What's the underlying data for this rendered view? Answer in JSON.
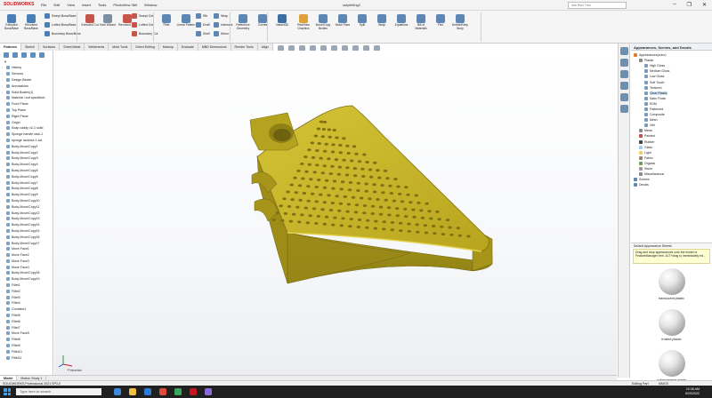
{
  "app": {
    "brand": "SOLIDWORKS",
    "document_title": "sstyletting2",
    "search_placeholder": "Ask Ravi Tran"
  },
  "menus": [
    "File",
    "Edit",
    "View",
    "Insert",
    "Tools",
    "PhotoView 360",
    "Window"
  ],
  "window_controls": [
    "–",
    "❐",
    "✕"
  ],
  "ribbon": {
    "big_tools": [
      {
        "label": "Extruded Boss/Base",
        "color": "#4a7fb8"
      },
      {
        "label": "Revolved Boss/Base",
        "color": "#4a7fb8"
      },
      {
        "label": "Extruded Cut",
        "color": "#c8554a"
      },
      {
        "label": "Hole Wizard",
        "color": "#7c8fa4"
      },
      {
        "label": "Revolved Cut",
        "color": "#c8554a"
      },
      {
        "label": "Fillet",
        "color": "#5f87b5"
      },
      {
        "label": "Linear Pattern",
        "color": "#5f87b5"
      },
      {
        "label": "Reference Geometry",
        "color": "#5f87b5"
      },
      {
        "label": "Curves",
        "color": "#5f87b5"
      },
      {
        "label": "Instant3D",
        "color": "#3a6ea5"
      },
      {
        "label": "RealView Graphics",
        "color": "#e0a03a"
      },
      {
        "label": "Move/Copy Bodies",
        "color": "#5f87b5"
      },
      {
        "label": "Move Face",
        "color": "#5f87b5"
      },
      {
        "label": "Split",
        "color": "#5f87b5"
      },
      {
        "label": "Wrap",
        "color": "#5f87b5"
      },
      {
        "label": "Equations",
        "color": "#5f87b5"
      },
      {
        "label": "Bill of Materials",
        "color": "#5f87b5"
      },
      {
        "label": "Flex",
        "color": "#5f87b5"
      },
      {
        "label": "Delete/Keep Body",
        "color": "#5f87b5"
      }
    ],
    "small_tools": [
      {
        "label": "Swept Boss/Base",
        "color": "#4a7fb8"
      },
      {
        "label": "Lofted Boss/Base",
        "color": "#4a7fb8"
      },
      {
        "label": "Boundary Boss/Base",
        "color": "#4a7fb8"
      },
      {
        "label": "Swept Cut",
        "color": "#c8554a"
      },
      {
        "label": "Lofted Cut",
        "color": "#c8554a"
      },
      {
        "label": "Boundary Cut",
        "color": "#c8554a"
      },
      {
        "label": "Rib",
        "color": "#5f87b5"
      },
      {
        "label": "Draft",
        "color": "#5f87b5"
      },
      {
        "label": "Shell",
        "color": "#5f87b5"
      },
      {
        "label": "Wrap",
        "color": "#5f87b5"
      },
      {
        "label": "Intersect",
        "color": "#5f87b5"
      },
      {
        "label": "Mirror",
        "color": "#5f87b5"
      }
    ]
  },
  "tabs": [
    "Features",
    "Sketch",
    "Surfaces",
    "Sheet Metal",
    "Weldments",
    "Mold Tools",
    "Direct Editing",
    "Markup",
    "Evaluate",
    "MBD Dimensions",
    "Render Tools",
    "Align"
  ],
  "feature_tree": {
    "filter_label": "▼",
    "items": [
      "History",
      "Sensors",
      "Design Binder",
      "Annotations",
      "Solid Bodies(1)",
      "Material <not specified>",
      "Front Plane",
      "Top Plane",
      "Right Plane",
      "Origin",
      "Soap caddy v2-1 solid",
      "Sponge handle rack-1",
      "sponge rack/cut-1 sol.",
      "Body-Move/Copy1",
      "Body-Move/Copy2",
      "Body-Move/Copy3",
      "Body-Move/Copy4",
      "Body-Move/Copy5",
      "Body-Move/Copy6",
      "Body-Move/Copy7",
      "Body-Move/Copy8",
      "Body-Move/Copy9",
      "Body-Move/Copy10",
      "Body-Move/Copy11",
      "Body-Move/Copy12",
      "Body-Move/Copy13",
      "Body-Move/Copy14",
      "Body-Move/Copy15",
      "Body-Move/Copy16",
      "Body-Move/Copy17",
      "Move Face1",
      "Move Face2",
      "Move Face3",
      "Move Face4",
      "Body-Move/Copy18",
      "Body-Move/Copy19",
      "Fillet1",
      "Fillet2",
      "Fillet3",
      "Fillet4",
      "Combine1",
      "Fillet5",
      "Fillet6",
      "Fillet7",
      "Move Face5",
      "Fillet8",
      "Fillet9",
      "Fillet10",
      "Fillet11"
    ]
  },
  "view": {
    "triad_label": "*Trimetric",
    "part_color": "#c9b72a",
    "part_edge": "#6e6214"
  },
  "appearances": {
    "title": "Appearances, Scenes, and Decals",
    "tree": [
      {
        "label": "Appearances(color)",
        "level": 0,
        "color": "#e07a2a"
      },
      {
        "label": "Plastic",
        "level": 1,
        "color": "#8a8a8a"
      },
      {
        "label": "High Gloss",
        "level": 2,
        "color": "#7a9dbf"
      },
      {
        "label": "Medium Gloss",
        "level": 2,
        "color": "#7a9dbf"
      },
      {
        "label": "Low Gloss",
        "level": 2,
        "color": "#7a9dbf"
      },
      {
        "label": "Soft Touch",
        "level": 2,
        "color": "#7a9dbf"
      },
      {
        "label": "Textured",
        "level": 2,
        "color": "#7a9dbf"
      },
      {
        "label": "Clear Plastic",
        "level": 2,
        "color": "#7a9dbf",
        "selected": true
      },
      {
        "label": "Satin Finish",
        "level": 2,
        "color": "#7a9dbf"
      },
      {
        "label": "EDM",
        "level": 2,
        "color": "#7a9dbf"
      },
      {
        "label": "Patterned",
        "level": 2,
        "color": "#7a9dbf"
      },
      {
        "label": "Composite",
        "level": 2,
        "color": "#7a9dbf"
      },
      {
        "label": "Mesh",
        "level": 2,
        "color": "#7a9dbf"
      },
      {
        "label": "Vitri",
        "level": 2,
        "color": "#7a9dbf"
      },
      {
        "label": "Metal",
        "level": 1,
        "color": "#8a8a8a"
      },
      {
        "label": "Painted",
        "level": 1,
        "color": "#c05050"
      },
      {
        "label": "Rubber",
        "level": 1,
        "color": "#444444"
      },
      {
        "label": "Glass",
        "level": 1,
        "color": "#9fd0e8"
      },
      {
        "label": "Light",
        "level": 1,
        "color": "#f0d060"
      },
      {
        "label": "Fabric",
        "level": 1,
        "color": "#a08070"
      },
      {
        "label": "Organic",
        "level": 1,
        "color": "#6aa050"
      },
      {
        "label": "Stone",
        "level": 1,
        "color": "#999999"
      },
      {
        "label": "Miscellaneous",
        "level": 1,
        "color": "#8a8a8a"
      },
      {
        "label": "Scenes",
        "level": 0,
        "color": "#5f87b5"
      },
      {
        "label": "Decals",
        "level": 0,
        "color": "#5f87b5"
      }
    ],
    "section_header": "Default Appearance Sheets",
    "tip": "Drag and drop appearances onto the model or FeatureManager tree. ALT+drag to immediately ed...",
    "thumbnails": [
      "translucent plastic",
      "frosted plastic",
      "polypropylene plastic"
    ]
  },
  "bottom_tabs": [
    "Model",
    "Motion Study 1"
  ],
  "status": {
    "left": "SOLIDWORKS Professional 2021 SP3.0",
    "editing": "Editing Part",
    "units": "MMGS"
  },
  "taskbar": {
    "search": "Type here to search",
    "time": "10:38 AM",
    "date": "5/20/2022",
    "apps": [
      "#3c8ad8",
      "#f0c040",
      "#2e7bd6",
      "#e04a3a",
      "#3ba55c",
      "#c4161c",
      "#8a6ad8"
    ]
  }
}
